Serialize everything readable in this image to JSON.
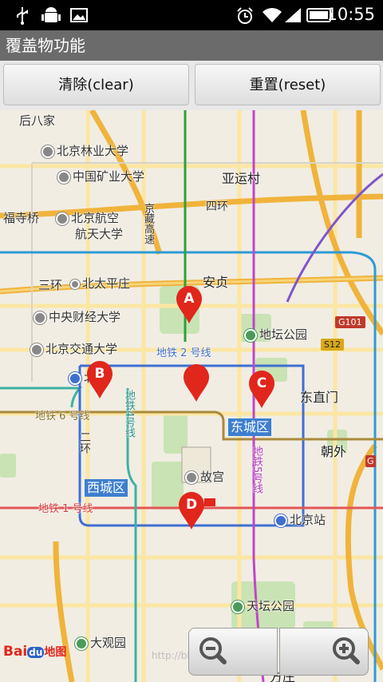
{
  "status_bar": {
    "time": "10:55",
    "left_icons": [
      "usb-icon",
      "android-debug-icon",
      "image-icon"
    ],
    "right_icons": [
      "alarm-icon",
      "wifi-icon",
      "signal-icon",
      "battery-icon"
    ]
  },
  "app": {
    "title": "覆盖物功能"
  },
  "buttons": {
    "clear": "清除(clear)",
    "reset": "重置(reset)"
  },
  "map": {
    "places": {
      "houbajia": "后八家",
      "bfu": "北京林业大学",
      "cumt": "中国矿业大学",
      "yayuncun": "亚运村",
      "wanfusi": "福寺桥",
      "buaa1": "北京航空",
      "buaa2": "航天大学",
      "zanggao": "京藏高速",
      "sihuan": "四环",
      "sanhuan": "三环",
      "beitaipingzhuang": "北太平庄",
      "andingzhen": "安贞",
      "cufe": "中央财经大学",
      "bjtu": "北京交通大学",
      "ditan": "地坛公园",
      "beizhan": "北站",
      "dongzhimen": "东直门",
      "chaowai": "朝外",
      "gugong": "故宫",
      "bjzhan": "北京站",
      "tiantan": "天坛公园",
      "daguanyuan": "大观园",
      "fangzhuang": "方庄",
      "erhuan_w": "二环",
      "line4": "地铁4号线",
      "line5": "地铁5号线"
    },
    "metro_lines": {
      "line2": "地铁 2 号线",
      "line6": "地铁 6 号线",
      "line1": "地铁 1 号线"
    },
    "districts": {
      "dongcheng": "东城区",
      "xicheng": "西城区"
    },
    "badges": {
      "g101": "G101",
      "s12": "S12"
    },
    "markers": [
      "A",
      "B",
      "C",
      "D"
    ],
    "watermark": "http://blog.csdn.net/bunker..."
  },
  "logo": {
    "bai": "Bai",
    "du": "du",
    "map": "地图"
  },
  "zoom": {
    "out": "zoom-out-icon",
    "in": "zoom-in-icon"
  },
  "colors": {
    "marker_red": "#e1261c",
    "title_bar": "#6b6b6b",
    "district_blue": "#3d7fd1",
    "line2_blue": "#3f6fd0",
    "line1_red": "#e35656",
    "line6_brown": "#a98a3b",
    "line5_purple": "#c046c8",
    "line4_teal": "#3cb2a4",
    "expressway_orange": "#f0b33b"
  }
}
